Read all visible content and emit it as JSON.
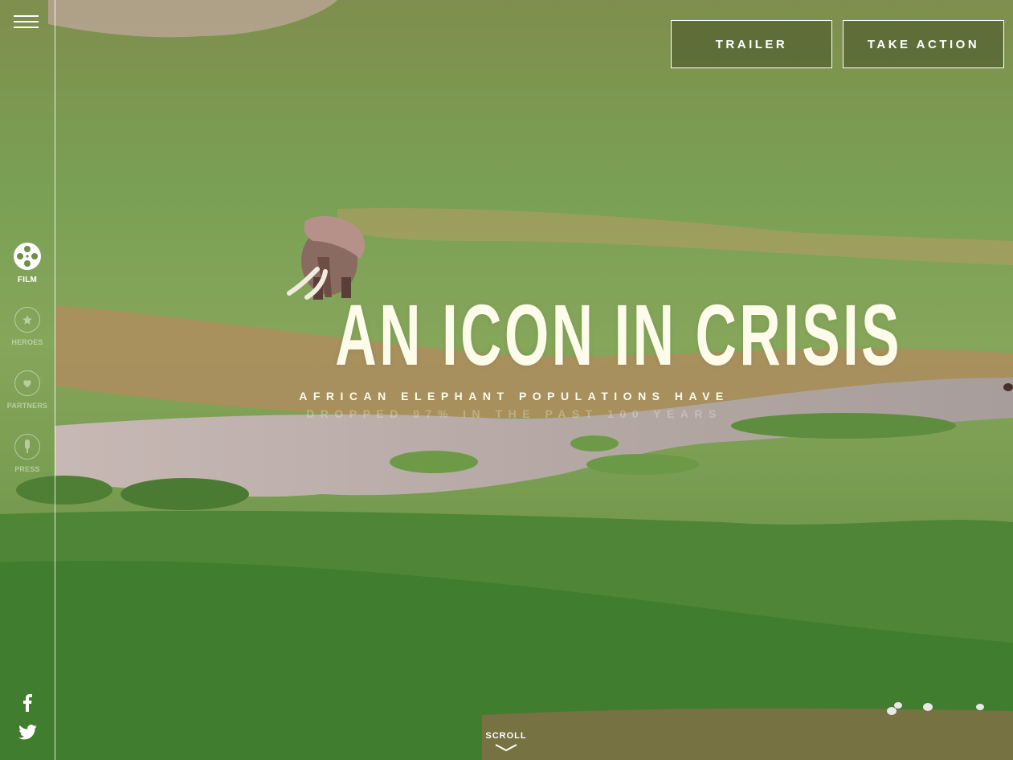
{
  "header": {
    "menu_icon": "hamburger-menu-icon",
    "trailer_label": "TRAILER",
    "take_action_label": "TAKE ACTION"
  },
  "sidebar": {
    "items": [
      {
        "label": "FILM",
        "icon": "film-reel-icon",
        "active": true
      },
      {
        "label": "HEROES",
        "icon": "star-icon",
        "active": false
      },
      {
        "label": "PARTNERS",
        "icon": "heart-icon",
        "active": false
      },
      {
        "label": "PRESS",
        "icon": "microphone-icon",
        "active": false
      }
    ],
    "social": [
      {
        "icon": "facebook-icon"
      },
      {
        "icon": "twitter-icon"
      }
    ]
  },
  "hero": {
    "title": "AN ICON IN CRISIS",
    "subtitle_line1": "AFRICAN ELEPHANT POPULATIONS HAVE",
    "subtitle_line2": "DROPPED 97% IN THE PAST 100 YEARS"
  },
  "scroll": {
    "label": "SCROLL",
    "icon": "chevron-down-icon"
  },
  "colors": {
    "text": "#fdfbe9",
    "grass": "#6f8f4a",
    "water": "#b7aaa3",
    "mud": "#a8875a",
    "button_bg": "#464f28"
  }
}
